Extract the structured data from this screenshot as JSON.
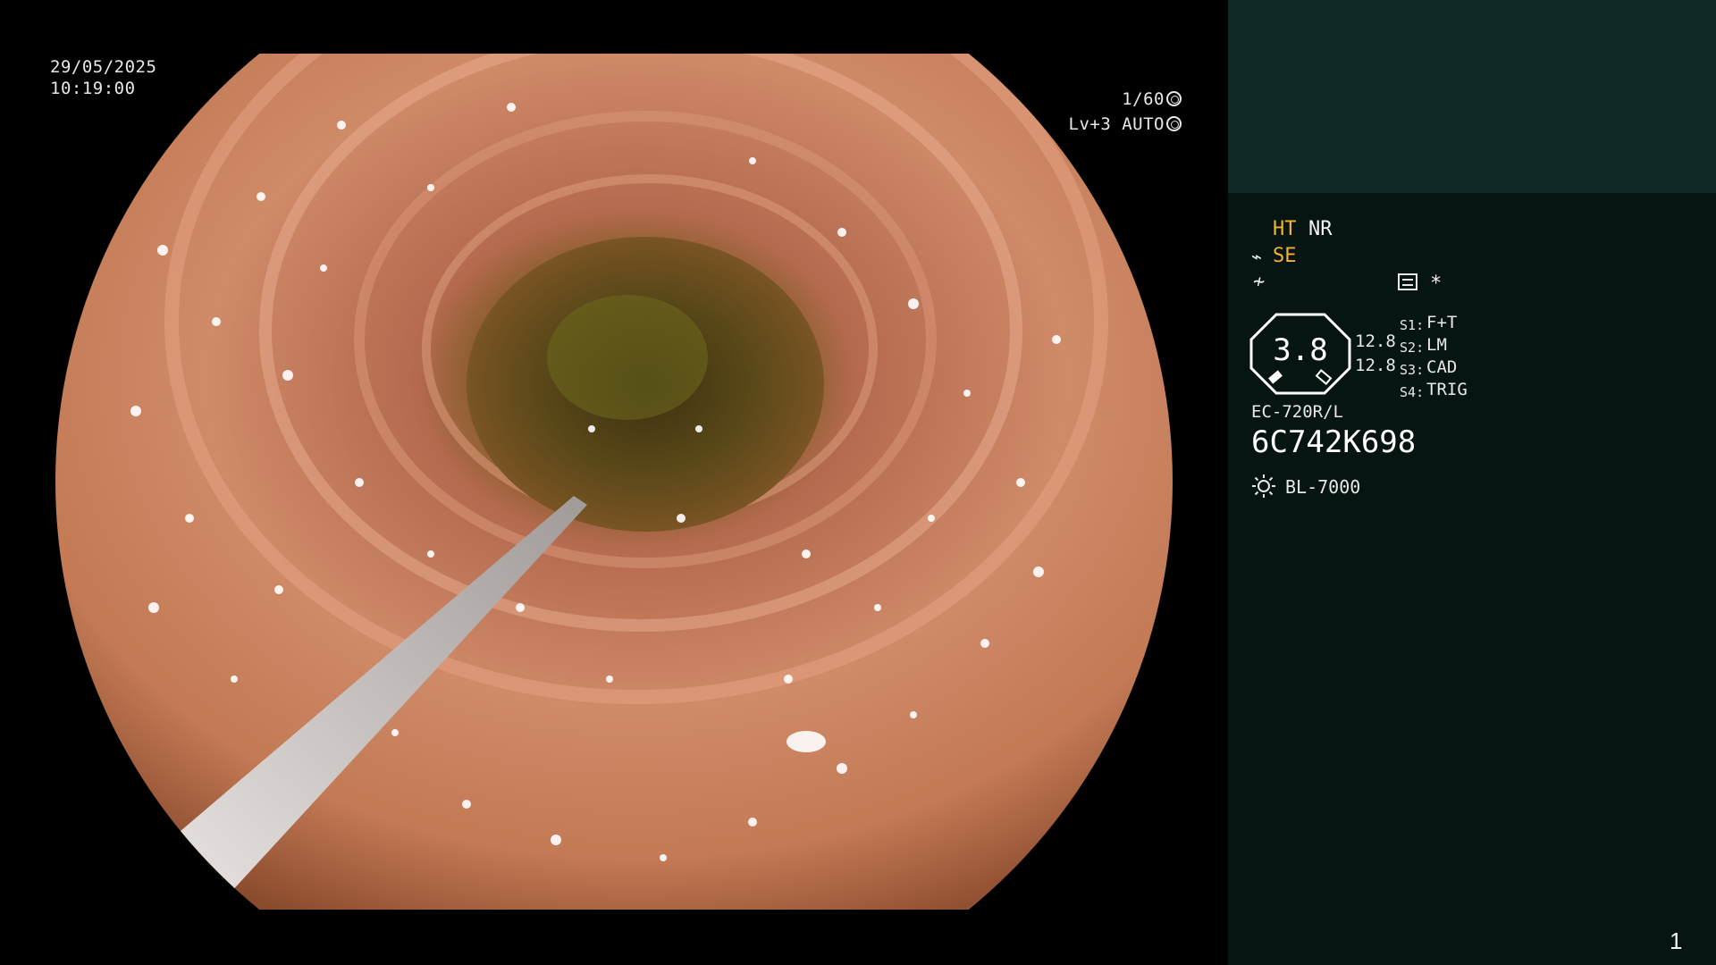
{
  "overlay": {
    "date": "29/05/2025",
    "time": "10:19:00",
    "shutter": "1/60",
    "level": "Lv+3 AUTO",
    "shutter_icon": "aperture-icon",
    "auto_icon": "iris-icon"
  },
  "panel": {
    "ht_label": "HT",
    "nr_label": "NR",
    "se_icon": "structure-enhance-icon",
    "se_label": "SE",
    "enhance_icon": "enhance-icon",
    "mode_icon": "image-mode-icon",
    "star": "*",
    "gauge_value": "3.8",
    "num_top": "12.8",
    "num_bottom": "12.8",
    "settings": [
      {
        "key": "S1",
        "value": "F+T"
      },
      {
        "key": "S2",
        "value": "LM"
      },
      {
        "key": "S3",
        "value": "CAD"
      },
      {
        "key": "S4",
        "value": "TRIG"
      }
    ],
    "scope_model": "EC-720R/L",
    "scope_serial": "6C742K698",
    "light_icon": "light-source-icon",
    "light_source": "BL-7000",
    "page_number": "1"
  },
  "colors": {
    "panel_top": "#0f2926",
    "panel": "#061512",
    "accent_yellow": "#f2b233",
    "tissue": "#c9805e"
  }
}
